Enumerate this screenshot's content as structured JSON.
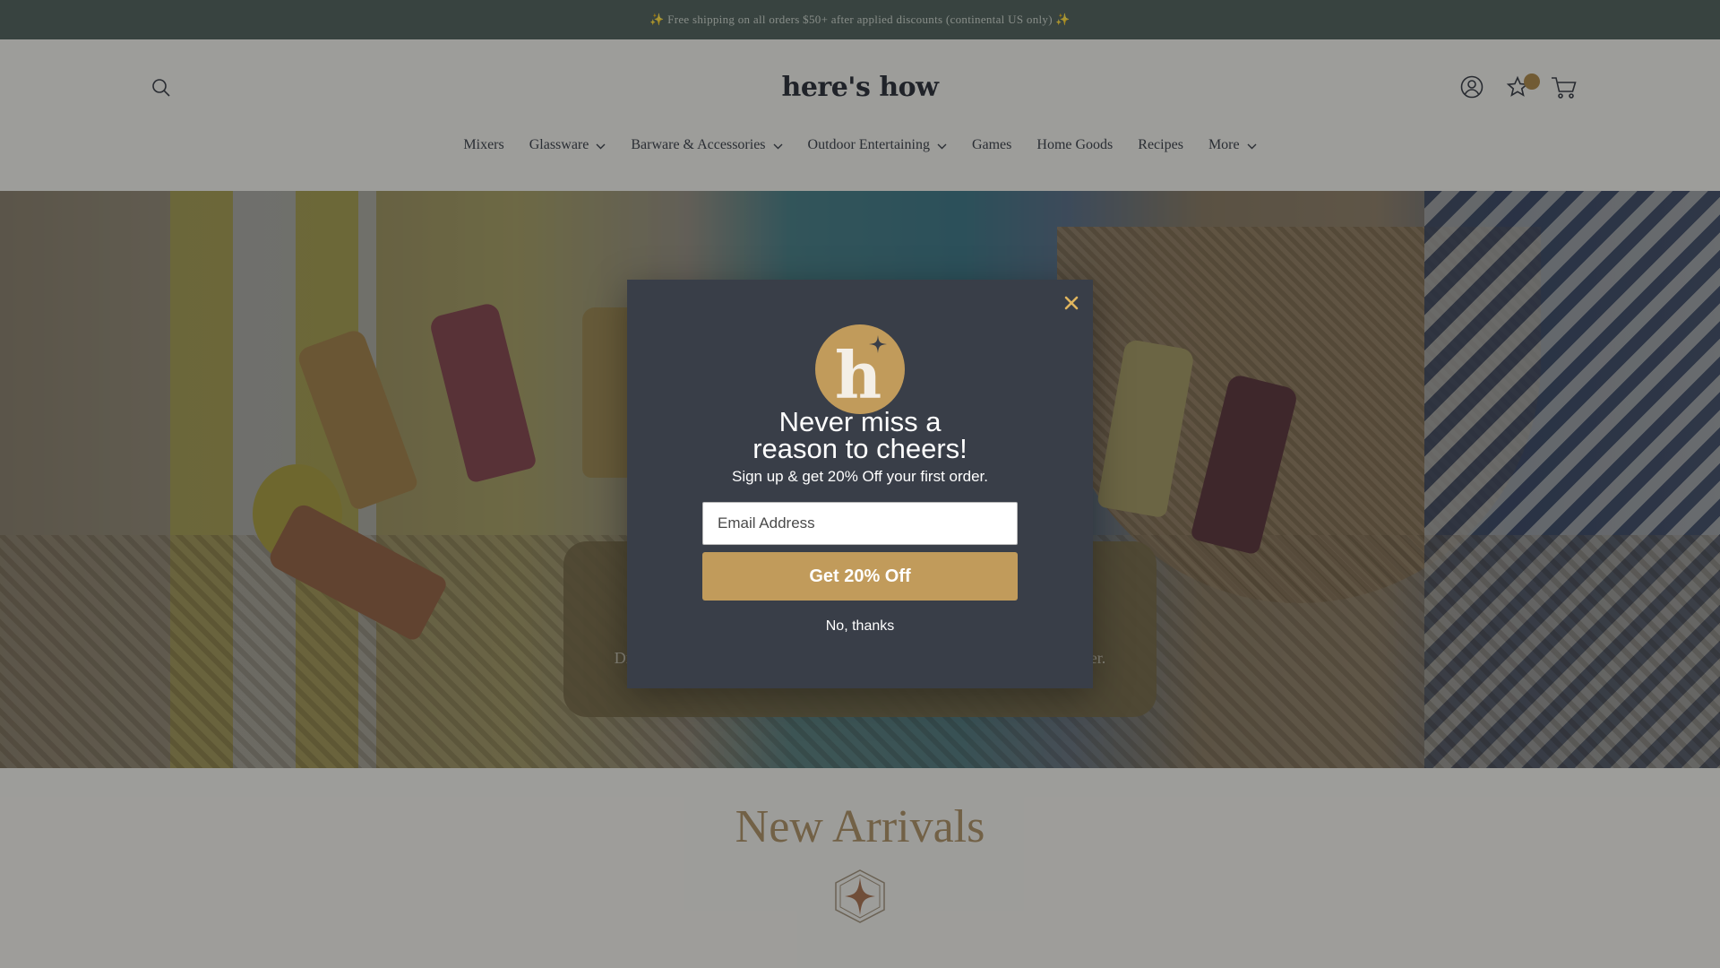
{
  "announcement": {
    "text": "✨ Free shipping on all orders $50+ after applied discounts (continental US only) ✨"
  },
  "header": {
    "logo_text": "here's how",
    "icons": {
      "search": "search-icon",
      "account": "account-icon",
      "wishlist": "star-icon",
      "cart": "cart-icon"
    },
    "wishlist_badge_color": "#a57e3c"
  },
  "nav": {
    "items": [
      {
        "label": "Mixers",
        "has_dropdown": false
      },
      {
        "label": "Glassware",
        "has_dropdown": true
      },
      {
        "label": "Barware & Accessories",
        "has_dropdown": true
      },
      {
        "label": "Outdoor Entertaining",
        "has_dropdown": true
      },
      {
        "label": "Games",
        "has_dropdown": false
      },
      {
        "label": "Home Goods",
        "has_dropdown": false
      },
      {
        "label": "Recipes",
        "has_dropdown": false
      },
      {
        "label": "More",
        "has_dropdown": true
      }
    ]
  },
  "hero": {
    "card_text_left": "Disc",
    "card_text_right": "ner."
  },
  "arrivals": {
    "title": "New Arrivals",
    "ornament_icon": "sparkle-ornament-icon"
  },
  "popup": {
    "logo_letter": "h",
    "title_line1": "Never miss a",
    "title_line2": "reason to cheers!",
    "subtitle": "Sign up & get 20% Off your first order.",
    "email_placeholder": "Email Address",
    "cta_label": "Get 20% Off",
    "decline_label": "No, thanks",
    "close_icon": "close-icon"
  },
  "colors": {
    "announcement_bg": "#4a5750",
    "page_bg": "#ece8e0",
    "popup_bg": "#393e48",
    "accent_gold": "#c19b5b",
    "close_x": "#e0b55e",
    "arrivals_title": "#a7885a"
  }
}
